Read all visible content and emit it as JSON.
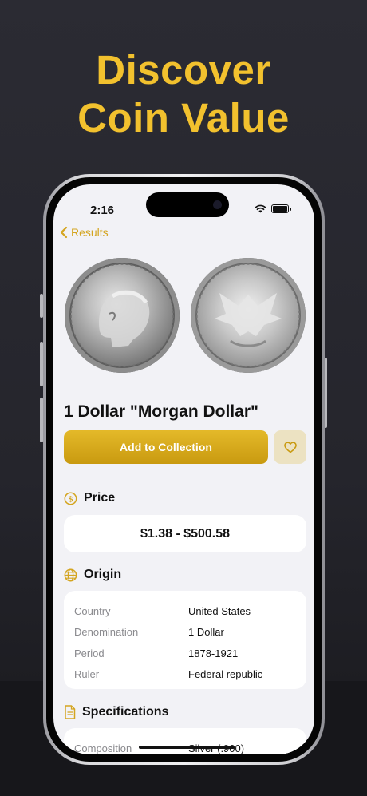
{
  "hero": {
    "line1": "Discover",
    "line2": "Coin Value",
    "color": "#f2c12e"
  },
  "status_bar": {
    "time": "2:16"
  },
  "nav": {
    "back_label": "Results"
  },
  "coin": {
    "title": "1 Dollar \"Morgan Dollar\"",
    "images": [
      "coin-obverse",
      "coin-reverse"
    ]
  },
  "actions": {
    "add_label": "Add to Collection",
    "favorite_icon": "heart-icon"
  },
  "price": {
    "heading": "Price",
    "icon": "dollar-circle-icon",
    "range": "$1.38 - $500.58"
  },
  "origin": {
    "heading": "Origin",
    "icon": "globe-icon",
    "rows": [
      {
        "key": "Country",
        "value": "United States"
      },
      {
        "key": "Denomination",
        "value": "1 Dollar"
      },
      {
        "key": "Period",
        "value": "1878-1921"
      },
      {
        "key": "Ruler",
        "value": "Federal republic"
      }
    ]
  },
  "specifications": {
    "heading": "Specifications",
    "icon": "document-icon",
    "rows": [
      {
        "key": "Composition",
        "value": "Silver (.900)"
      }
    ]
  },
  "colors": {
    "accent": "#d4a520",
    "button": "#c99a10",
    "fav_bg": "#ece2c2",
    "background": "#f2f2f6"
  }
}
